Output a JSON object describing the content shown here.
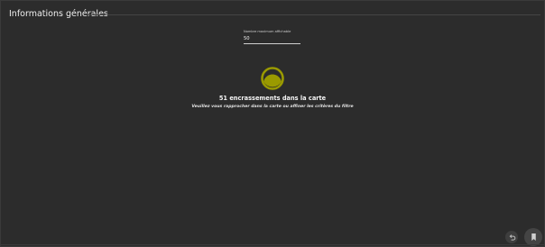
{
  "header": {
    "title": "Informations générales"
  },
  "max_display_field": {
    "label": "Nombre maximum affichable",
    "value": "50"
  },
  "summary": {
    "count_text": "51 encrassements dans la carte",
    "hint_text": "Veuillez vous rapprocher dans la carte ou affiner les critères du filtre"
  },
  "indicator": {
    "icon": "half-filled-circle-icon",
    "color": "#9a9a00"
  },
  "actions": {
    "undo_icon": "undo-icon",
    "bookmark_icon": "bookmark-icon"
  },
  "colors": {
    "background": "#2c2c2c",
    "accent": "#9a9a00"
  }
}
